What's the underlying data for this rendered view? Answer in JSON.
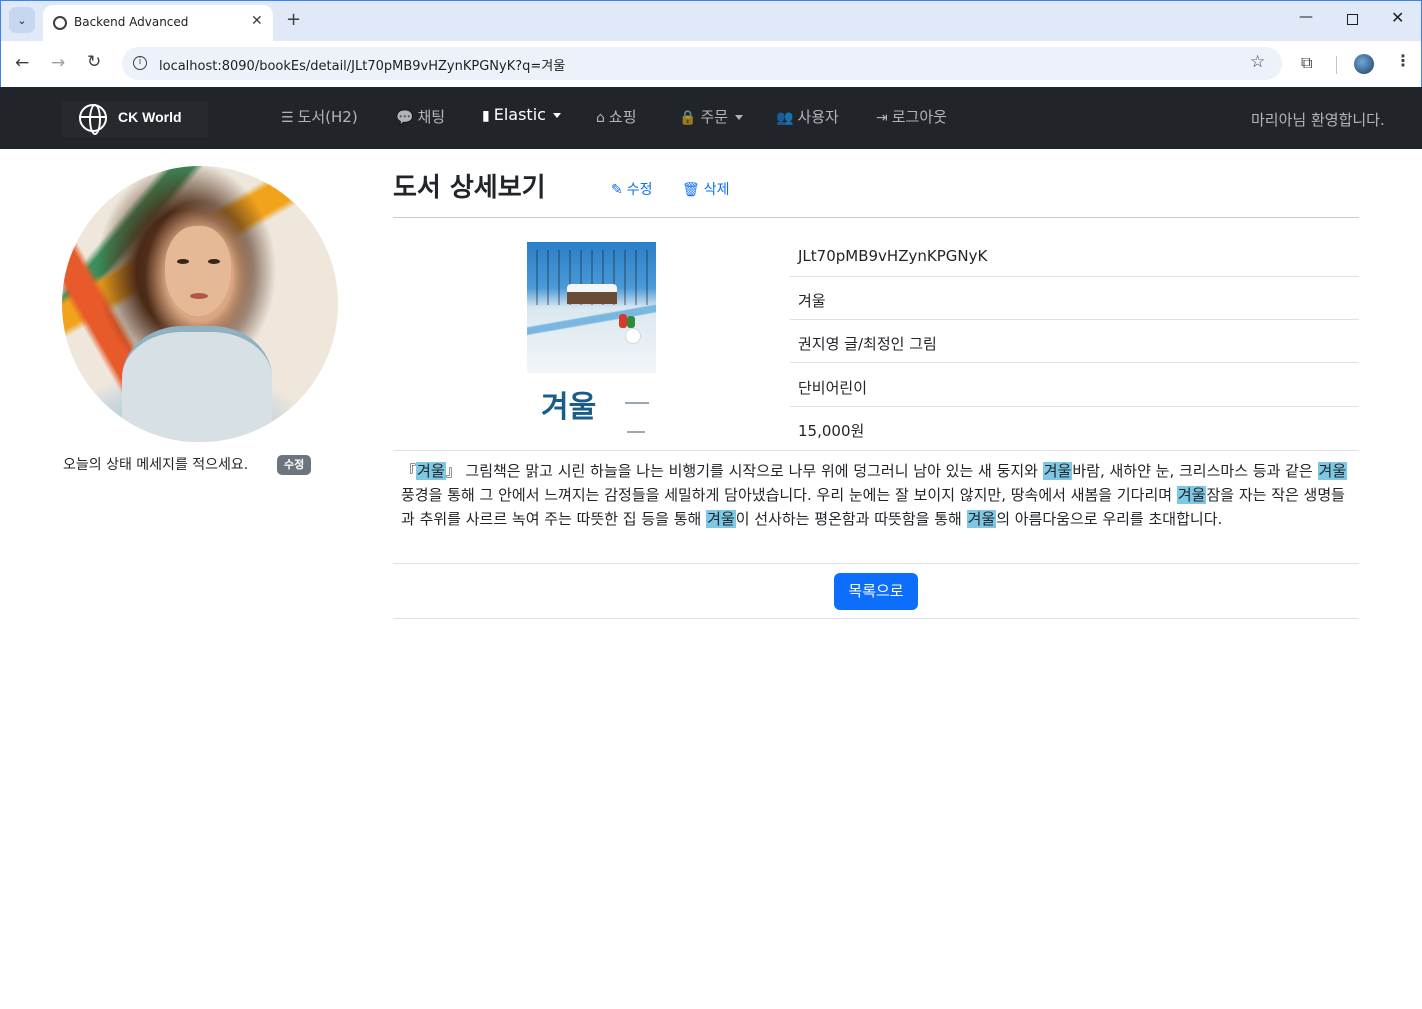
{
  "browser": {
    "tab_title": "Backend Advanced",
    "url": "localhost:8090/bookEs/detail/JLt70pMB9vHZynKPGNyK?q=겨울"
  },
  "navbar": {
    "brand": "CK World",
    "items": [
      {
        "label": "도서(H2)",
        "icon": "list-icon"
      },
      {
        "label": "채팅",
        "icon": "comments-icon"
      },
      {
        "label": "Elastic",
        "icon": "file-icon"
      },
      {
        "label": "쇼핑",
        "icon": "basket-icon"
      },
      {
        "label": "주문",
        "icon": "lock-icon"
      },
      {
        "label": "사용자",
        "icon": "users-icon"
      },
      {
        "label": "로그아웃",
        "icon": "sign-out-icon"
      }
    ],
    "welcome": "마리아님 환영합니다."
  },
  "sidebar": {
    "status_message": "오늘의 상태 메세지를 적으세요.",
    "edit_badge": "수정"
  },
  "main": {
    "title": "도서 상세보기",
    "edit_label": "수정",
    "delete_label": "삭제",
    "book": {
      "cover_title": "겨울",
      "id": "JLt70pMB9vHZynKPGNyK",
      "title": "겨울",
      "author": "권지영 글/최정인 그림",
      "publisher": "단비어린이",
      "price": "15,000원"
    },
    "description": [
      {
        "text": "『",
        "hl": false
      },
      {
        "text": "겨울",
        "hl": true
      },
      {
        "text": "』 그림책은 맑고 시린 하늘을 나는 비행기를 시작으로 나무 위에 덩그러니 남아 있는 새 둥지와 ",
        "hl": false
      },
      {
        "text": "겨울",
        "hl": true
      },
      {
        "text": "바람, 새하얀 눈, 크리스마스 등과 같은 ",
        "hl": false
      },
      {
        "text": "겨울",
        "hl": true
      },
      {
        "text": " 풍경을 통해 그 안에서 느껴지는 감정들을 세밀하게 담아냈습니다. 우리 눈에는 잘 보이지 않지만, 땅속에서 새봄을 기다리며 ",
        "hl": false
      },
      {
        "text": "겨울",
        "hl": true
      },
      {
        "text": "잠을 자는 작은 생명들과 추위를 사르르 녹여 주는 따뜻한 집 등을 통해 ",
        "hl": false
      },
      {
        "text": "겨울",
        "hl": true
      },
      {
        "text": "이 선사하는 평온함과 따뜻함을 통해 ",
        "hl": false
      },
      {
        "text": "겨울",
        "hl": true
      },
      {
        "text": "의 아름다움으로 우리를 초대합니다.",
        "hl": false
      }
    ],
    "list_button": "목록으로"
  },
  "colors": {
    "navbar_bg": "#212529",
    "primary": "#0d6efd",
    "highlight": "#7ec8e3",
    "badge": "#6c757d"
  }
}
